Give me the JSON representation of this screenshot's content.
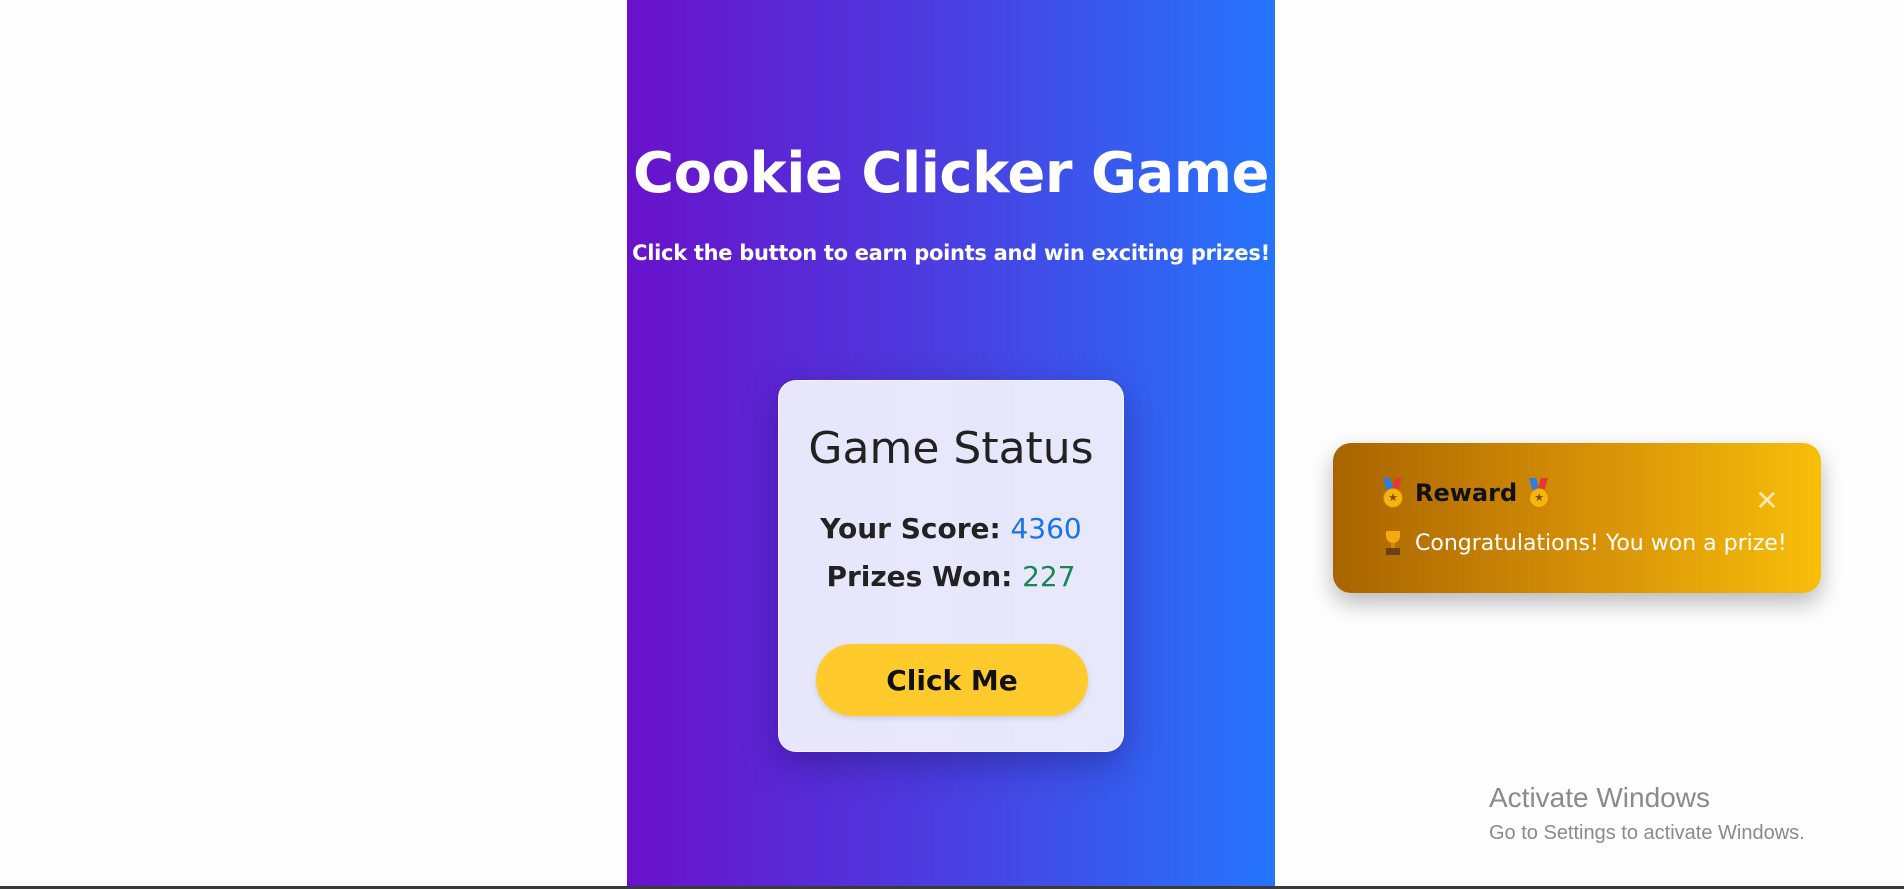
{
  "game": {
    "title": "Cookie Clicker Game",
    "subtitle": "Click the button to earn points and win exciting prizes!"
  },
  "status_card": {
    "title": "Game Status",
    "score_label": "Your Score:",
    "score_value": "4360",
    "prizes_label": "Prizes Won:",
    "prizes_value": "227",
    "button_label": "Click Me"
  },
  "toast": {
    "title": "Reward",
    "message": "Congratulations! You won a prize!",
    "close_glyph": "✕",
    "icons": [
      "medal-icon",
      "trophy-icon",
      "close-icon"
    ]
  },
  "watermark": {
    "title": "Activate Windows",
    "subtitle": "Go to Settings to activate Windows."
  },
  "colors": {
    "gradient_start": "#6a11cb",
    "gradient_end": "#2575fc",
    "button": "#ffca2c",
    "score_value": "#1a73e8",
    "prizes_value": "#198754",
    "toast_start": "#a86400",
    "toast_end": "#f7be0a"
  }
}
